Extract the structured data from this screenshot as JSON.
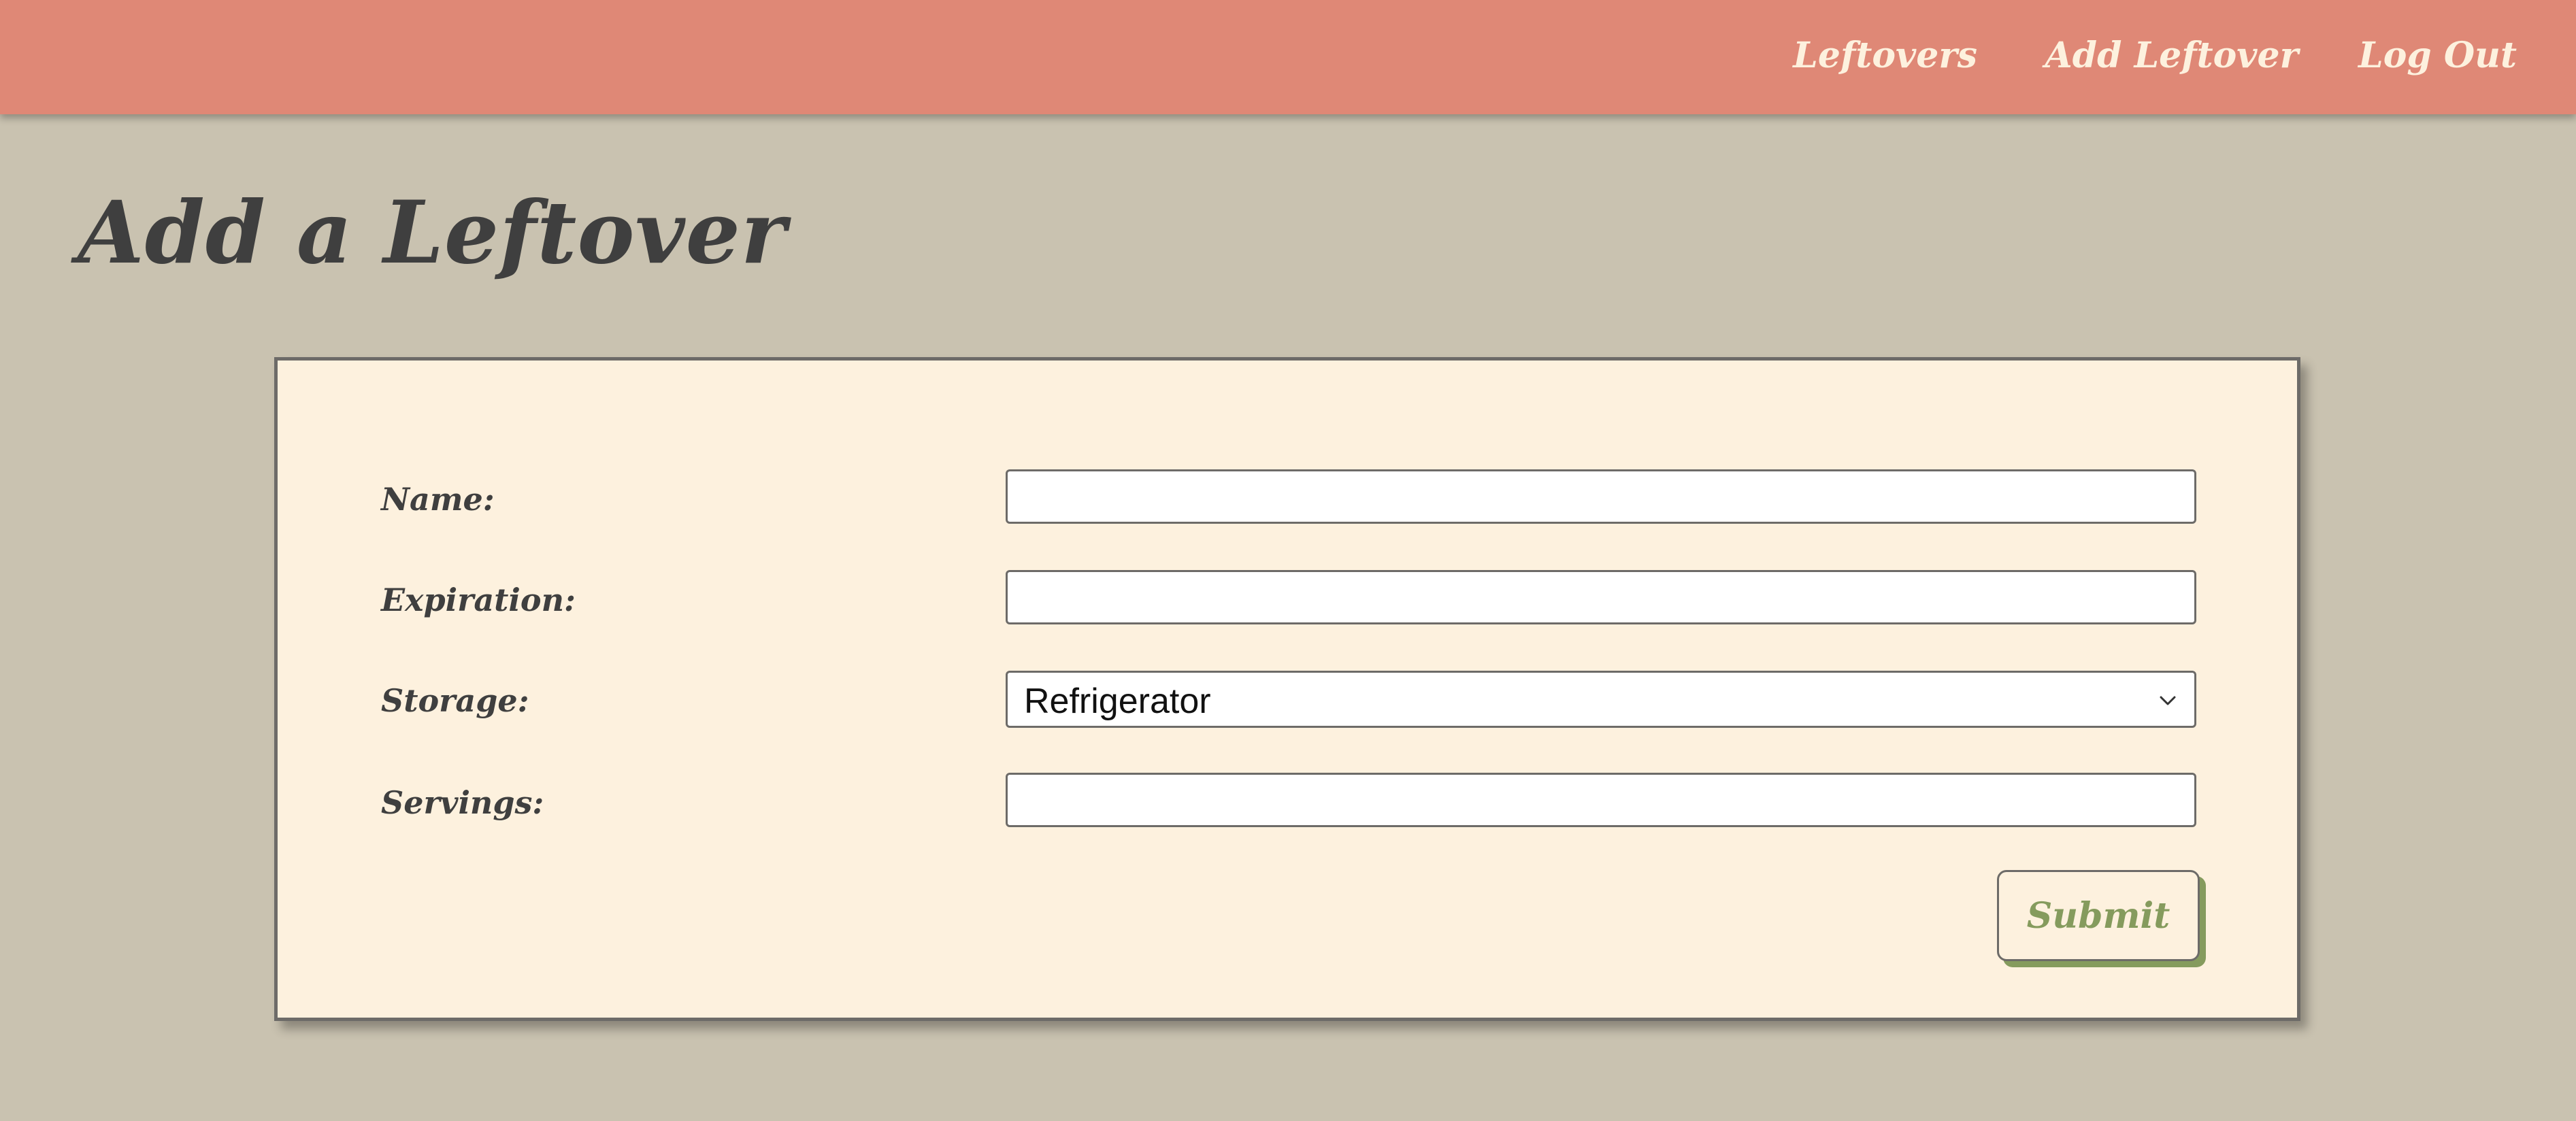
{
  "nav": {
    "links": [
      {
        "label": "Leftovers"
      },
      {
        "label": "Add Leftover"
      },
      {
        "label": "Log Out"
      }
    ]
  },
  "page": {
    "title": "Add a Leftover"
  },
  "form": {
    "fields": {
      "name": {
        "label": "Name:",
        "value": ""
      },
      "expiration": {
        "label": "Expiration:",
        "value": ""
      },
      "storage": {
        "label": "Storage:",
        "selected": "Refrigerator"
      },
      "servings": {
        "label": "Servings:",
        "value": ""
      }
    },
    "submit_label": "Submit"
  },
  "colors": {
    "navbar": "#df8876",
    "nav_text": "#fdf1de",
    "background": "#c9c2b0",
    "card": "#fdf1de",
    "text": "#3f3f3f",
    "accent": "#859b5d"
  },
  "icons": {
    "select_arrow": "chevron-down-icon"
  }
}
